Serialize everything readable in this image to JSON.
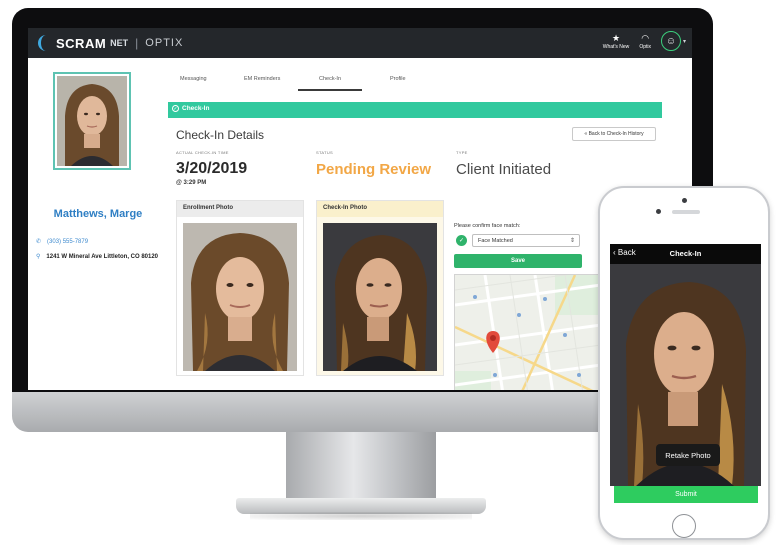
{
  "app": {
    "brand": "SCRAM",
    "brand_suffix": "NET",
    "separator": "|",
    "product": "OPTIX",
    "top_actions": [
      {
        "label": "What's New",
        "icon": "star-icon"
      },
      {
        "label": "Optix",
        "icon": "gauge-icon"
      }
    ],
    "avatar_icon": "user-avatar-icon"
  },
  "client": {
    "name": "Matthews, Marge",
    "phone": "(303) 555-7879",
    "address": "1241 W Mineral Ave Littleton, CO 80120"
  },
  "tabs": [
    "Messaging",
    "EM Reminders",
    "Check-In",
    "Profile"
  ],
  "active_tab": "Check-In",
  "banner": {
    "label": "Check-In",
    "color": "#31c99e"
  },
  "checkin": {
    "title": "Check-In Details",
    "history_button": "« Back to Check-In History",
    "date_label": "ACTUAL CHECK-IN TIME",
    "date": "3/20/2019",
    "time": "@ 3:29 PM",
    "status_label": "STATUS",
    "status": "Pending Review",
    "status_color": "#f2a746",
    "type_label": "TYPE",
    "type": "Client Initiated",
    "enrollment_photo_label": "Enrollment Photo",
    "checkin_photo_label": "Check-In Photo",
    "confirm_label": "Please confirm face match:",
    "face_match_value": "Face Matched",
    "save_label": "Save"
  },
  "phone": {
    "back_label": "Back",
    "title": "Check-In",
    "retake_label": "Retake Photo",
    "submit_label": "Submit"
  }
}
